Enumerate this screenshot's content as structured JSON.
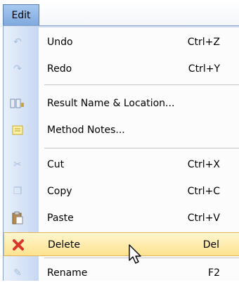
{
  "menubar": {
    "title": "Edit"
  },
  "menu": {
    "items": [
      {
        "label": "Undo",
        "shortcut": "Ctrl+Z",
        "icon": "undo-icon"
      },
      {
        "label": "Redo",
        "shortcut": "Ctrl+Y",
        "icon": "redo-icon"
      },
      {
        "label": "Result Name & Location...",
        "shortcut": "",
        "icon": "result-name-icon"
      },
      {
        "label": "Method Notes...",
        "shortcut": "",
        "icon": "notes-icon"
      },
      {
        "label": "Cut",
        "shortcut": "Ctrl+X",
        "icon": "cut-icon"
      },
      {
        "label": "Copy",
        "shortcut": "Ctrl+C",
        "icon": "copy-icon"
      },
      {
        "label": "Paste",
        "shortcut": "Ctrl+V",
        "icon": "paste-icon"
      },
      {
        "label": "Delete",
        "shortcut": "Del",
        "icon": "delete-icon"
      },
      {
        "label": "Rename",
        "shortcut": "F2",
        "icon": "rename-icon"
      }
    ],
    "selected": "Delete"
  },
  "colors": {
    "highlight": "#fde38f",
    "delete_icon": "#d9332a",
    "gutter": "#c7d8f2"
  }
}
